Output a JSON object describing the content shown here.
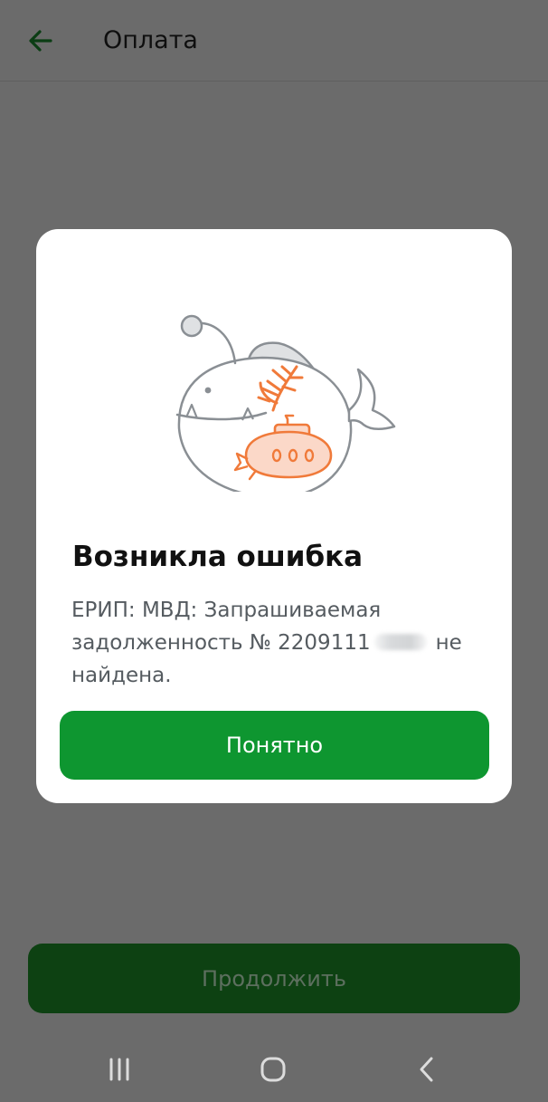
{
  "header": {
    "back_icon": "arrow-left-icon",
    "title": "Оплата"
  },
  "footer": {
    "continue_label": "Продолжить"
  },
  "dialog": {
    "illustration": "anglerfish-with-submarine",
    "title": "Возникла ошибка",
    "message_before": "ЕРИП: МВД: Запрашиваемая задолженность № 2209111",
    "message_after": "не найдена.",
    "ok_label": "Понятно"
  },
  "system_nav": {
    "recents_icon": "recents-icon",
    "home_icon": "home-icon",
    "back_icon": "back-chevron-icon"
  },
  "colors": {
    "overlay": "#6b6b6b",
    "accent_green": "#0e9630",
    "dimmed_green": "#0d4112",
    "illustration_orange": "#f07a3a"
  }
}
